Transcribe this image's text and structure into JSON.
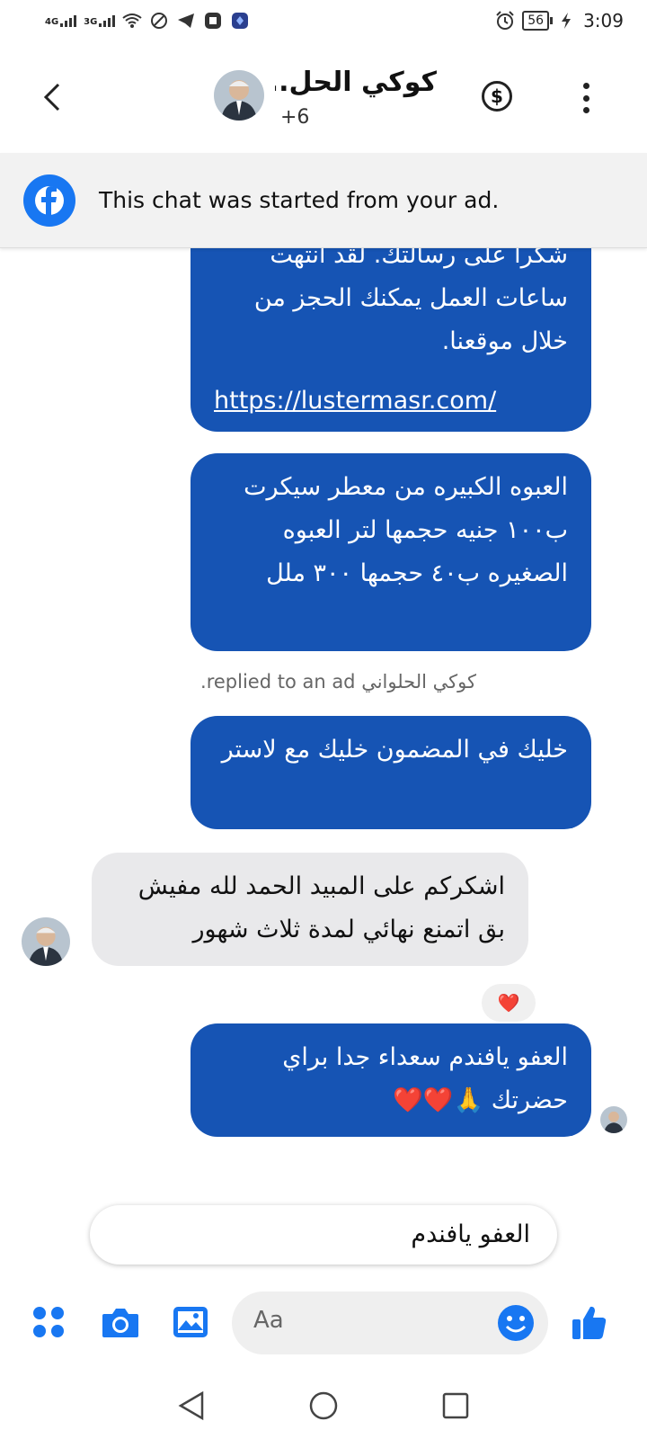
{
  "status_bar": {
    "net1": "4G",
    "net2": "3G",
    "battery": "56",
    "time": "3:09"
  },
  "header": {
    "title": "كوكي الحل...",
    "subtitle": "+6"
  },
  "banner": {
    "text": "This chat was started from your ad."
  },
  "messages": [
    {
      "direction": "out",
      "text": "شكرا على رسالتك. لقد انتهت ساعات العمل يمكنك الحجز من خلال موقعنا.",
      "link": "https://lustermasr.com/"
    },
    {
      "direction": "out",
      "text": "العبوه الكبيره من معطر سيكرت ب١٠٠ جنيه حجمها لتر العبوه الصغيره ب٤٠ حجمها ٣٠٠ ملل"
    },
    {
      "direction": "out",
      "text": "خليك في المضمون خليك مع لاستر"
    },
    {
      "direction": "in",
      "text": "اشكركم على المبيد الحمد لله مفيش بق اتمنع نهائي لمدة ثلاث شهور",
      "reaction": "❤️"
    },
    {
      "direction": "out",
      "text": "العفو يافندم سعداء جدا براي حضرتك 🙏❤️❤️"
    }
  ],
  "ad_reply_note": "كوكي الحلواني replied to an ad.",
  "suggested_reply": "العفو يافندم",
  "composer": {
    "placeholder": "Aa"
  },
  "colors": {
    "outgoing_bubble": "#1654b4",
    "incoming_bubble": "#e9e9eb",
    "accent": "#1877f2"
  }
}
